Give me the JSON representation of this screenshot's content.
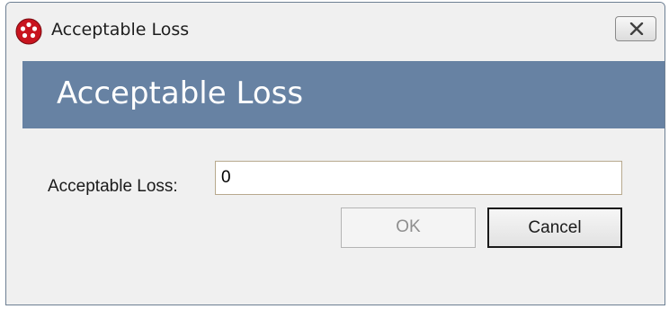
{
  "window": {
    "title": "Acceptable Loss",
    "app_icon": "red-dots-icon",
    "close_icon": "close-icon"
  },
  "banner": {
    "title": "Acceptable Loss",
    "background": "#6782a3"
  },
  "form": {
    "label": "Acceptable Loss:",
    "value": "0"
  },
  "buttons": {
    "ok_label": "OK",
    "ok_disabled": true,
    "cancel_label": "Cancel"
  }
}
